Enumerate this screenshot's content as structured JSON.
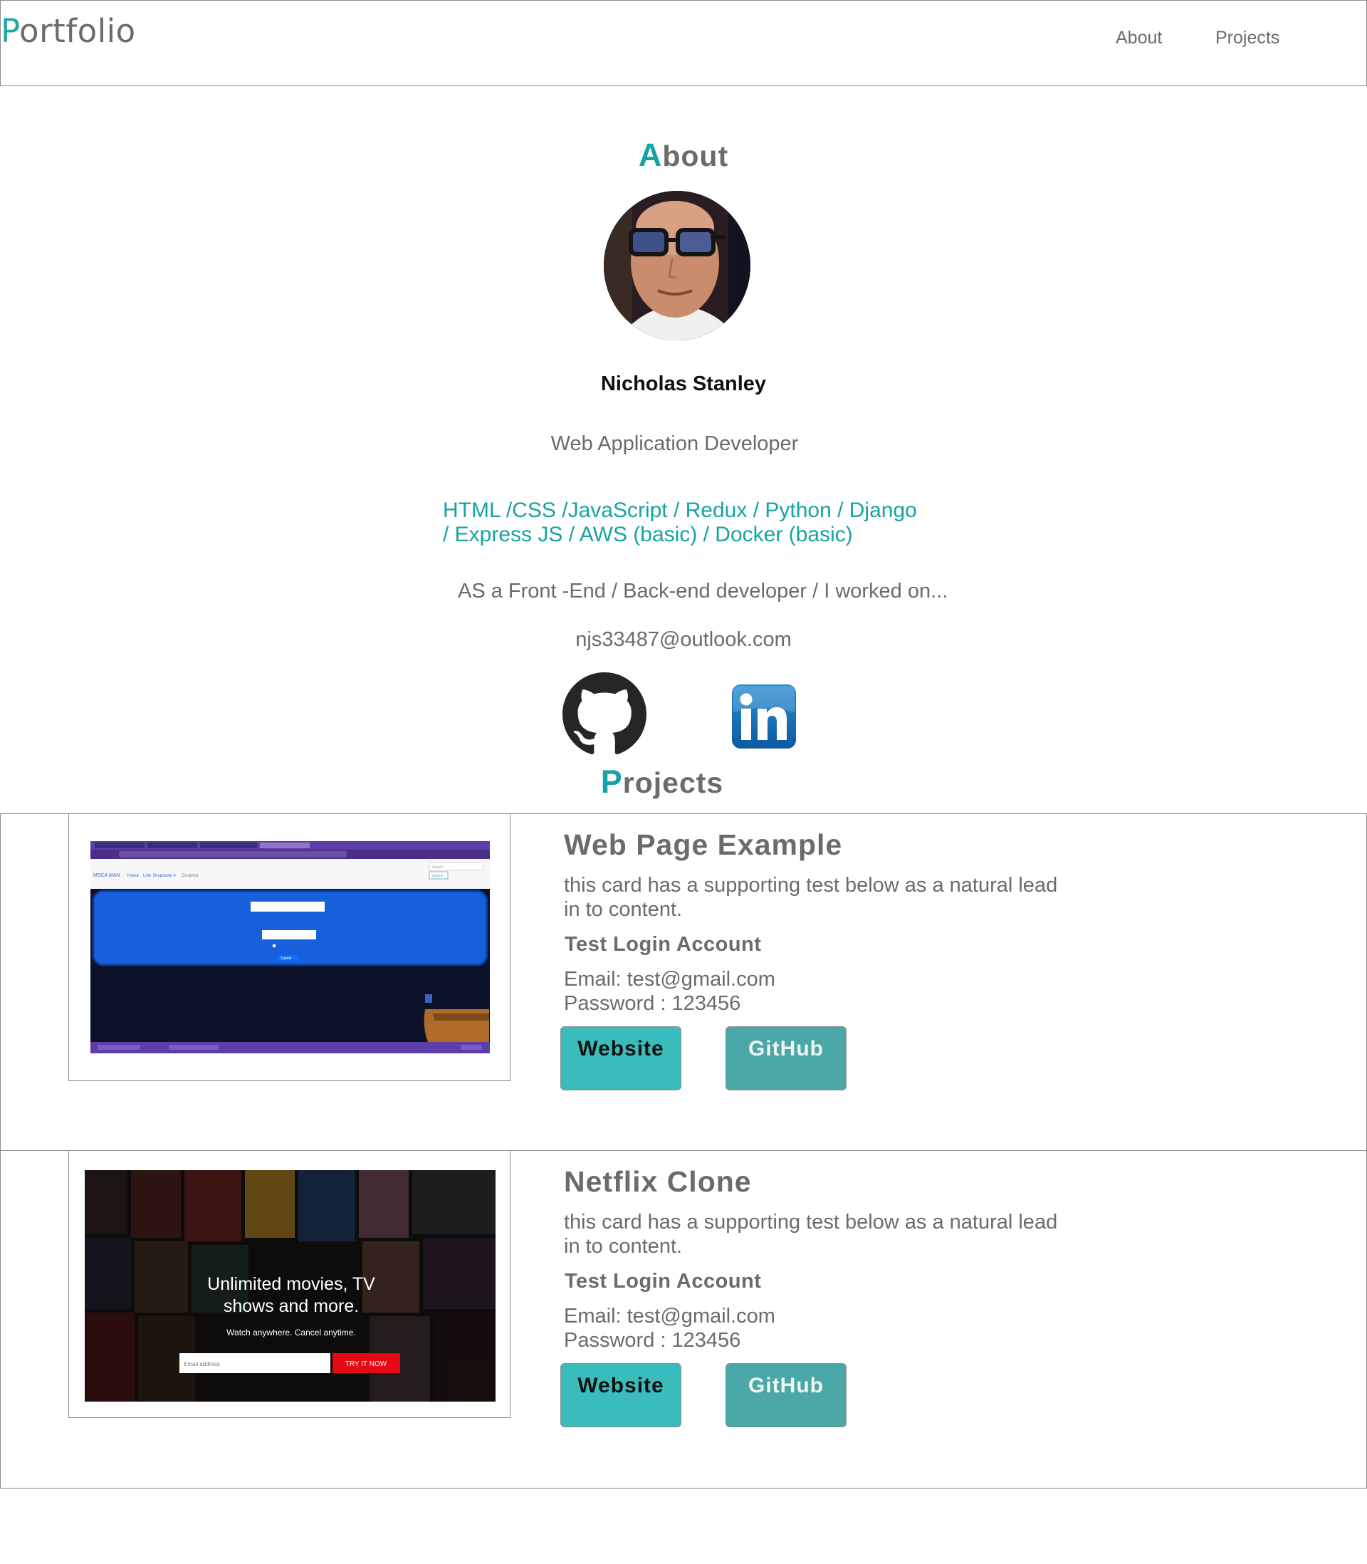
{
  "header": {
    "logo": "Portfolio",
    "logo_first": "P",
    "logo_rest": "ortfolio",
    "nav": [
      {
        "label": "About"
      },
      {
        "label": "Projects"
      }
    ]
  },
  "about": {
    "title_first": "A",
    "title_rest": "bout",
    "name": "Nicholas Stanley",
    "role": "Web Application Developer",
    "skills_line1": "HTML /CSS /JavaScript / Redux / Python / Django",
    "skills_line2": "/ Express JS / AWS (basic) / Docker (basic)",
    "blurb": "AS a Front -End / Back-end developer / I worked on...",
    "email": "njs33487@outlook.com",
    "social": [
      {
        "icon": "github-icon"
      },
      {
        "icon": "linkedin-icon"
      }
    ]
  },
  "projects": {
    "title_first": "P",
    "title_rest": "rojects",
    "cards": [
      {
        "title": "Web Page Example",
        "text": "this card has a supporting test below as a natural lead in to content.",
        "sub": "Test Login Account",
        "email": "Email: test@gmail.com",
        "password": "Password : 123456",
        "website_label": "Website",
        "github_label": "GitHub",
        "thumb": {
          "site_name": "MSCA MAN",
          "nav_links": [
            "Home",
            "Link",
            "Dropdown ▾",
            "Disabled"
          ],
          "search_placeholder": "Search",
          "search_button": "Search",
          "submit_label": "Submit"
        }
      },
      {
        "title": "Netflix Clone",
        "text": "this card has a supporting test below as a natural lead in to content.",
        "sub": "Test Login Account",
        "email": "Email: test@gmail.com",
        "password": "Password : 123456",
        "website_label": "Website",
        "github_label": "GitHub",
        "thumb": {
          "headline1": "Unlimited movies, TV",
          "headline2": "shows and more.",
          "tagline": "Watch anywhere. Cancel anytime.",
          "email_placeholder": "Email address",
          "cta": "TRY IT NOW"
        }
      }
    ]
  },
  "colors": {
    "accent": "#17a3a3",
    "text": "#6b6b6b",
    "website_button": "#3bbcbc",
    "github_button": "#4aa9a6"
  }
}
